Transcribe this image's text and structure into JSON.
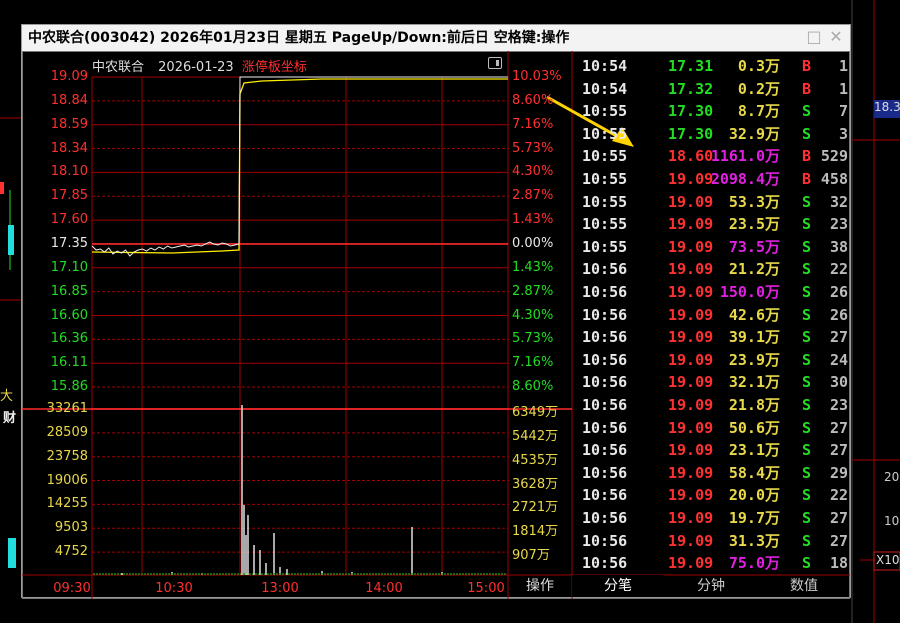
{
  "window": {
    "title": "中农联合(003042) 2026年01月23日 星期五 PageUp/Down:前后日 空格键:操作"
  },
  "chart_header": {
    "name": "中农联合",
    "date": "2026-01-23",
    "mode": "涨停板坐标"
  },
  "colors": {
    "up": "#ff3030",
    "down": "#22dd22",
    "flat": "#e8e8e8",
    "volume_label": "#e8d84a",
    "big_order": "#e020e0",
    "price_line": "#ffee00",
    "grid": "#a00000"
  },
  "price_axis": {
    "left": [
      "19.09",
      "18.84",
      "18.59",
      "18.34",
      "18.10",
      "17.85",
      "17.60",
      "17.35",
      "17.10",
      "16.85",
      "16.60",
      "16.36",
      "16.11",
      "15.86"
    ],
    "right": [
      "10.03%",
      "8.60%",
      "7.16%",
      "5.73%",
      "4.30%",
      "2.87%",
      "1.43%",
      "0.00%",
      "1.43%",
      "2.87%",
      "4.30%",
      "5.73%",
      "7.16%",
      "8.60%"
    ]
  },
  "volume_axis": {
    "left": [
      "33261",
      "28509",
      "23758",
      "19006",
      "14255",
      "9503",
      "4752"
    ],
    "right": [
      "6349万",
      "5442万",
      "4535万",
      "3628万",
      "2721万",
      "1814万",
      "907万"
    ]
  },
  "time_axis": [
    "09:30",
    "10:30",
    "13:00",
    "14:00",
    "15:00"
  ],
  "chart_data": {
    "type": "line",
    "x": [
      "09:30",
      "10:30",
      "11:30/13:00",
      "14:00",
      "15:00"
    ],
    "series": [
      {
        "values": [
          17.35,
          17.3,
          17.35,
          19.09,
          19.09
        ]
      }
    ],
    "ylim": [
      15.86,
      19.09
    ]
  },
  "ticks": [
    {
      "time": "10:54",
      "price": "17.31",
      "vol": "0.3万",
      "bs": "B",
      "n": "1",
      "pc": "down",
      "vc": "yellow"
    },
    {
      "time": "10:54",
      "price": "17.32",
      "vol": "0.2万",
      "bs": "B",
      "n": "1",
      "pc": "down",
      "vc": "yellow"
    },
    {
      "time": "10:55",
      "price": "17.30",
      "vol": "8.7万",
      "bs": "S",
      "n": "7",
      "pc": "down",
      "vc": "yellow"
    },
    {
      "time": "10:55",
      "price": "17.30",
      "vol": "32.9万",
      "bs": "S",
      "n": "3",
      "pc": "down",
      "vc": "yellow"
    },
    {
      "time": "10:55",
      "price": "18.60",
      "vol": "1161.0万",
      "bs": "B",
      "n": "529",
      "pc": "up",
      "vc": "magenta"
    },
    {
      "time": "10:55",
      "price": "19.09",
      "vol": "2098.4万",
      "bs": "B",
      "n": "458",
      "pc": "up",
      "vc": "magenta"
    },
    {
      "time": "10:55",
      "price": "19.09",
      "vol": "53.3万",
      "bs": "S",
      "n": "32",
      "pc": "up",
      "vc": "yellow"
    },
    {
      "time": "10:55",
      "price": "19.09",
      "vol": "23.5万",
      "bs": "S",
      "n": "23",
      "pc": "up",
      "vc": "yellow"
    },
    {
      "time": "10:55",
      "price": "19.09",
      "vol": "73.5万",
      "bs": "S",
      "n": "38",
      "pc": "up",
      "vc": "magenta"
    },
    {
      "time": "10:56",
      "price": "19.09",
      "vol": "21.2万",
      "bs": "S",
      "n": "22",
      "pc": "up",
      "vc": "yellow"
    },
    {
      "time": "10:56",
      "price": "19.09",
      "vol": "150.0万",
      "bs": "S",
      "n": "26",
      "pc": "up",
      "vc": "magenta"
    },
    {
      "time": "10:56",
      "price": "19.09",
      "vol": "42.6万",
      "bs": "S",
      "n": "26",
      "pc": "up",
      "vc": "yellow"
    },
    {
      "time": "10:56",
      "price": "19.09",
      "vol": "39.1万",
      "bs": "S",
      "n": "27",
      "pc": "up",
      "vc": "yellow"
    },
    {
      "time": "10:56",
      "price": "19.09",
      "vol": "23.9万",
      "bs": "S",
      "n": "24",
      "pc": "up",
      "vc": "yellow"
    },
    {
      "time": "10:56",
      "price": "19.09",
      "vol": "32.1万",
      "bs": "S",
      "n": "30",
      "pc": "up",
      "vc": "yellow"
    },
    {
      "time": "10:56",
      "price": "19.09",
      "vol": "21.8万",
      "bs": "S",
      "n": "23",
      "pc": "up",
      "vc": "yellow"
    },
    {
      "time": "10:56",
      "price": "19.09",
      "vol": "50.6万",
      "bs": "S",
      "n": "27",
      "pc": "up",
      "vc": "yellow"
    },
    {
      "time": "10:56",
      "price": "19.09",
      "vol": "23.1万",
      "bs": "S",
      "n": "27",
      "pc": "up",
      "vc": "yellow"
    },
    {
      "time": "10:56",
      "price": "19.09",
      "vol": "58.4万",
      "bs": "S",
      "n": "29",
      "pc": "up",
      "vc": "yellow"
    },
    {
      "time": "10:56",
      "price": "19.09",
      "vol": "20.0万",
      "bs": "S",
      "n": "22",
      "pc": "up",
      "vc": "yellow"
    },
    {
      "time": "10:56",
      "price": "19.09",
      "vol": "19.7万",
      "bs": "S",
      "n": "27",
      "pc": "up",
      "vc": "yellow"
    },
    {
      "time": "10:56",
      "price": "19.09",
      "vol": "31.3万",
      "bs": "S",
      "n": "27",
      "pc": "up",
      "vc": "yellow"
    },
    {
      "time": "10:56",
      "price": "19.09",
      "vol": "75.0万",
      "bs": "S",
      "n": "18",
      "pc": "up",
      "vc": "magenta"
    }
  ],
  "bottom_tabs": {
    "operate": "操作",
    "tick": "分笔",
    "minute": "分钟",
    "value": "数值"
  },
  "background_fragments": {
    "left_big": "大",
    "left_cai": "财",
    "right_price": "18.3",
    "right_x": "X10",
    "right_20": "20",
    "right_10": "10"
  }
}
